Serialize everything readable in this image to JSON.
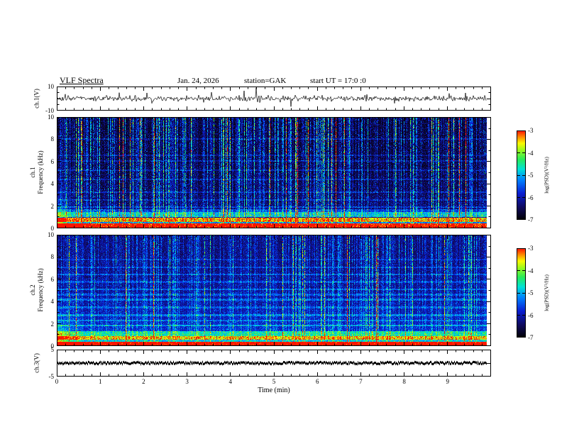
{
  "header": {
    "title": "VLF Spectra",
    "date": "Jan. 24, 2026",
    "station": "station=GAK",
    "start_ut": "start UT =  17:0 :0"
  },
  "xaxis": {
    "label": "Time (min)",
    "lim": [
      0,
      10
    ],
    "ticks": [
      0,
      1,
      2,
      3,
      4,
      5,
      6,
      7,
      8,
      9
    ],
    "minor_tick_step": 0.2,
    "data_end_min": 9.9
  },
  "chart_data": [
    {
      "type": "line",
      "name": "ch1-voltage-waveform",
      "ylabel": "ch.1(V)",
      "ylim": [
        -10,
        10
      ],
      "yticks": [
        10,
        -10
      ],
      "xlim": [
        0,
        10
      ],
      "description": "Broadband noise waveform centered on 0 V, typical amplitude about ±2 V with frequent impulsive spikes reaching about ±8 V; data extends from 0 to ~9.9 min",
      "line_color": "#000000"
    },
    {
      "type": "heatmap",
      "name": "ch1-spectrogram",
      "ylabel": "ch.1 Frequency (kHz)",
      "ylabel_line1": "ch.1",
      "ylabel_line2": "Frequency (kHz)",
      "ylim": [
        0,
        10
      ],
      "yticks": [
        0,
        2,
        4,
        6,
        8,
        10
      ],
      "xlim": [
        0,
        10
      ],
      "colormap": "black-blue-cyan-green-yellow-red",
      "colorbar": {
        "label": "log(PSD)(V²/Hz)",
        "range": [
          -7,
          -3
        ],
        "ticks": [
          -3,
          -4,
          -5,
          -6,
          -7
        ]
      },
      "features": {
        "background_level_logpsd": -6.9,
        "strong_band_khz": [
          0,
          1.0
        ],
        "secondary_band_khz": [
          1.05,
          1.6
        ],
        "vertical_streaks": "dense sferic impulses spanning 0-10 kHz, green/yellow with red tips, stronger toward high frequency",
        "startup_enhancement_min": [
          0,
          0.5
        ],
        "faint_horizontal_lines_khz": [
          1.95,
          2.6,
          3.3,
          4.45,
          5.25,
          6.1,
          6.6,
          8.05
        ]
      }
    },
    {
      "type": "heatmap",
      "name": "ch2-spectrogram",
      "ylabel": "ch.2 Frequency (kHz)",
      "ylabel_line1": "ch.2",
      "ylabel_line2": "Frequency (kHz)",
      "ylim": [
        0,
        10
      ],
      "yticks": [
        0,
        2,
        4,
        6,
        8,
        10
      ],
      "xlim": [
        0,
        10
      ],
      "colormap": "black-blue-cyan-green-yellow-red",
      "colorbar": {
        "label": "log(PSD)(V²/Hz)",
        "range": [
          -7,
          -3
        ],
        "ticks": [
          -3,
          -4,
          -5,
          -6,
          -7
        ]
      },
      "features": {
        "background_level_logpsd": -6.6,
        "strong_band_khz": [
          0,
          0.95
        ],
        "secondary_band_khz": [
          0.95,
          1.35
        ],
        "vertical_streaks": "sferic impulses spanning 0-10 kHz, mostly blue/cyan/green, sparser than ch.1",
        "startup_enhancement_min": [
          0,
          0.5
        ],
        "faint_horizontal_lines_khz": [
          1.9,
          2.35,
          2.8,
          3.5,
          4.2,
          4.65,
          5.15,
          5.8,
          6.45,
          7.1,
          7.8
        ]
      }
    },
    {
      "type": "line",
      "name": "ch3-voltage-waveform",
      "ylabel": "ch.3(V)",
      "ylim": [
        -5,
        5
      ],
      "yticks": [
        5,
        -5
      ],
      "xlim": [
        0,
        10
      ],
      "description": "Essentially flat trace at 0 V (thin dense dark band) from 0 to ~9.9 min",
      "value": 0,
      "line_color": "#000000"
    }
  ]
}
